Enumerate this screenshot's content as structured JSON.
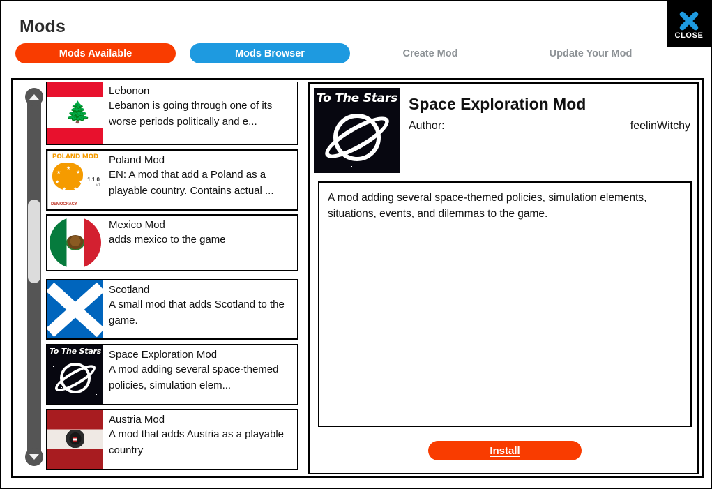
{
  "header": {
    "title": "Mods",
    "tabs": [
      {
        "label": "Mods Available",
        "state": "active-orange",
        "color": "#f93c00"
      },
      {
        "label": "Mods Browser",
        "state": "active-blue",
        "color": "#1e9ae0"
      },
      {
        "label": "Create Mod",
        "state": "inactive",
        "color": "#8d9296"
      },
      {
        "label": "Update Your Mod",
        "state": "inactive",
        "color": "#8d9296"
      }
    ],
    "close": {
      "label": "CLOSE",
      "icon": "close-x-icon",
      "color": "#1e9ae0",
      "background": "#000000"
    }
  },
  "mod_list": {
    "scrollbar": {
      "up_arrow": "chevron-up-icon",
      "down_arrow": "chevron-down-icon",
      "track_color": "#555555",
      "thumb_color": "#dcdcdc"
    },
    "items": [
      {
        "name": "Lebonon",
        "description": "Lebanon is going through one of its worse periods politically and e...",
        "thumb": "lebanon-flag"
      },
      {
        "name": "Poland Mod",
        "description": "EN: A mod that add a Poland as a playable country. Contains actual ...",
        "thumb": "poland-mod-cover",
        "thumb_title": "POLAND MOD",
        "thumb_version": "1.1.0",
        "thumb_footer": "DEMOCRACY"
      },
      {
        "name": "Mexico Mod",
        "description": "adds mexico to the game",
        "thumb": "mexico-flag"
      },
      {
        "name": "Scotland",
        "description": "A small mod that adds Scotland to the game.",
        "thumb": "scotland-flag"
      },
      {
        "name": "Space Exploration Mod",
        "description": "A mod adding several space-themed policies, simulation elem...",
        "thumb": "space-mod-cover",
        "thumb_title": "To The Stars"
      },
      {
        "name": "Austria Mod",
        "description": "A mod that adds Austria as a playable country",
        "thumb": "austria-flag"
      }
    ]
  },
  "detail": {
    "thumb": "space-mod-cover",
    "thumb_title": "To The Stars",
    "title": "Space Exploration Mod",
    "author_label": "Author:",
    "author_value": "feelinWitchy",
    "description": "A mod adding several space-themed policies, simulation elements, situations, events, and dilemmas to the game.",
    "install_label": "Install",
    "install_color": "#f93c00"
  }
}
